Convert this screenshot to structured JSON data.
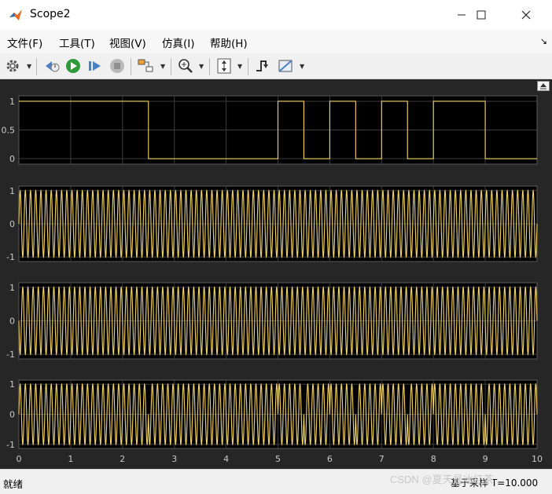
{
  "window": {
    "title": "Scope2"
  },
  "menu": {
    "items": [
      "文件(F)",
      "工具(T)",
      "视图(V)",
      "仿真(I)",
      "帮助(H)"
    ]
  },
  "toolbar": {
    "icons": [
      "settings-icon",
      "step-back-icon",
      "run-icon",
      "step-forward-icon",
      "stop-icon",
      "highlight-block-icon",
      "zoom-icon",
      "autoscale-icon",
      "triggers-icon",
      "measurements-icon"
    ]
  },
  "status": {
    "left": "就绪",
    "right": "基于采样  T=10.000",
    "watermark": "CSDN @夏天是冰红茶"
  },
  "colors": {
    "plot_bg": "#000000",
    "figure_bg": "#262626",
    "trace": "#f2d46b",
    "axis_text": "#c8c8c8",
    "grid": "#3c3c3c"
  },
  "chart_data": [
    {
      "type": "line",
      "description_key": "digital",
      "xlim": [
        0,
        10
      ],
      "ylim": [
        0,
        1
      ],
      "yticks": [
        "1",
        "0.5",
        "0"
      ],
      "ytick_values": [
        1,
        0.5,
        0
      ],
      "bits": [
        1,
        1,
        1,
        1,
        1,
        0,
        0,
        0,
        0,
        0,
        1,
        0,
        1,
        0,
        1,
        0,
        1,
        1,
        0,
        0
      ],
      "bit_duration": 0.5,
      "grid": true
    },
    {
      "type": "line",
      "description_key": "carrier-1",
      "xlim": [
        0,
        10
      ],
      "ylim": [
        -1,
        1
      ],
      "yticks": [
        "1",
        "0",
        "-1"
      ],
      "ytick_values": [
        1,
        0,
        -1
      ],
      "frequency": 10,
      "grid": true
    },
    {
      "type": "line",
      "description_key": "carrier-2",
      "xlim": [
        0,
        10
      ],
      "ylim": [
        -1,
        1
      ],
      "yticks": [
        "1",
        "0",
        "-1"
      ],
      "ytick_values": [
        1,
        0,
        -1
      ],
      "frequency": 10,
      "grid": true
    },
    {
      "type": "line",
      "description_key": "modulated",
      "xlim": [
        0,
        10
      ],
      "ylim": [
        -1,
        1
      ],
      "yticks": [
        "1",
        "0",
        "-1"
      ],
      "ytick_values": [
        1,
        0,
        -1
      ],
      "frequency": 10,
      "xticks": [
        "0",
        "1",
        "2",
        "3",
        "4",
        "5",
        "6",
        "7",
        "8",
        "9",
        "10"
      ],
      "xtick_values": [
        0,
        1,
        2,
        3,
        4,
        5,
        6,
        7,
        8,
        9,
        10
      ],
      "grid": true
    }
  ]
}
